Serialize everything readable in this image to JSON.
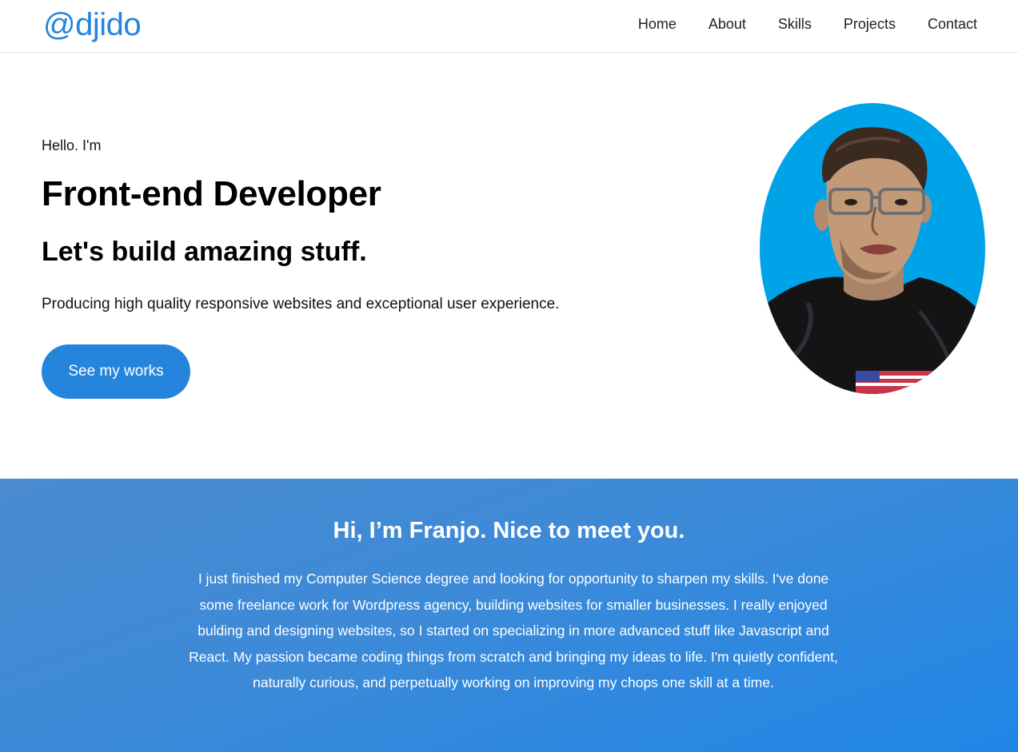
{
  "nav": {
    "logo": "@djido",
    "links": [
      "Home",
      "About",
      "Skills",
      "Projects",
      "Contact"
    ]
  },
  "hero": {
    "greeting": "Hello. I'm",
    "title": "Front-end Developer",
    "subtitle": "Let's build amazing stuff.",
    "description": "Producing high quality responsive websites and exceptional user experience.",
    "cta_label": "See my works"
  },
  "about": {
    "title": "Hi, I’m Franjo. Nice to meet you.",
    "text": "I just finished my Computer Science degree and looking for opportunity to sharpen my skills. I've done some freelance work for Wordpress agency, building websites for smaller businesses. I really enjoyed bulding and designing websites, so I started on specializing in more advanced stuff like Javascript and React. My passion became coding things from scratch and bringing my ideas to life. I'm quietly confident, naturally curious, and perpetually working on improving my chops one skill at a time."
  },
  "colors": {
    "accent": "#2585dc",
    "about_bg_start": "#4a8acf",
    "about_bg_end": "#1f86e6",
    "avatar_bg": "#00a2e8"
  },
  "icons": {
    "avatar": "portrait-illustration"
  }
}
